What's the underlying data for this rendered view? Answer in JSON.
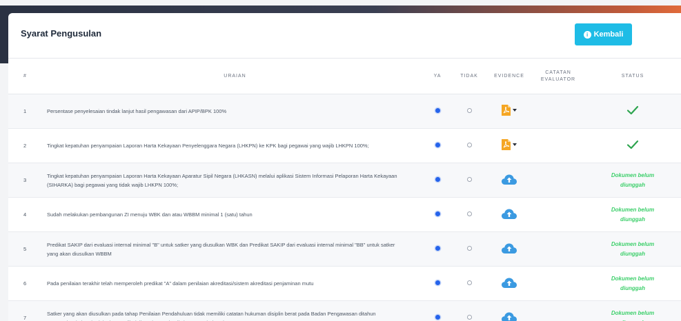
{
  "page": {
    "title": "Syarat Pengusulan",
    "back_button_label": "Kembali"
  },
  "table": {
    "columns": {
      "num": "#",
      "desc": "URAIAN",
      "ya": "YA",
      "tidak": "TIDAK",
      "evidence": "EVIDENCE",
      "catatan": "CATATAN EVALUATOR",
      "status": "STATUS"
    },
    "rows": [
      {
        "num": "1",
        "desc": "Persentase penyelesaian tindak lanjut hasil pengawasan dari APIP/BPK 100%",
        "ya": true,
        "evidence": "pdf-icon",
        "status": "check",
        "status_text": ""
      },
      {
        "num": "2",
        "desc": "Tingkat kepatuhan penyampaian Laporan Harta Kekayaan Penyelenggara Negara (LHKPN) ke KPK bagi pegawai yang wajib LHKPN 100%;",
        "ya": true,
        "evidence": "pdf-icon",
        "status": "check",
        "status_text": ""
      },
      {
        "num": "3",
        "desc": "Tingkat kepatuhan penyampaian Laporan Harta Kekayaan Aparatur Sipil Negara (LHKASN) melalui aplikasi Sistem Informasi Pelaporan Harta Kekayaan (SIHARKA) bagi pegawai yang tidak wajib LHKPN 100%;",
        "ya": true,
        "evidence": "cloud-upload-icon",
        "status": "text",
        "status_text": "Dokumen belum diunggah"
      },
      {
        "num": "4",
        "desc": "Sudah melakukan pembangunan ZI menuju WBK dan atau WBBM minimal 1 (satu) tahun",
        "ya": true,
        "evidence": "cloud-upload-icon",
        "status": "text",
        "status_text": "Dokumen belum diunggah"
      },
      {
        "num": "5",
        "desc": "Predikat SAKIP dari evaluasi internal minimal \"B\" untuk satker yang diusulkan WBK dan Predikat SAKIP dari evaluasi internal minimal \"BB\" untuk satker yang akan diusulkan WBBM",
        "ya": true,
        "evidence": "cloud-upload-icon",
        "status": "text",
        "status_text": "Dokumen belum diunggah"
      },
      {
        "num": "6",
        "desc": "Pada penilaian terakhir telah memperoleh predikat \"A\" dalam penilaian akreditasi/sistem akreditasi penjaminan mutu",
        "ya": true,
        "evidence": "cloud-upload-icon",
        "status": "text",
        "status_text": "Dokumen belum diunggah"
      },
      {
        "num": "7",
        "desc": "Satker yang akan diusulkan pada tahap Penilaian Pendahuluan tidak memiliki catatan hukuman disiplin berat pada Badan Pengawasan ditahun pengusulan (tahun berjalan) yang dibuktikan dengan hasil clearance dari Badan Pengawasan MA RI",
        "ya": true,
        "evidence": "cloud-upload-icon",
        "status": "text",
        "status_text": "Dokumen belum diunggah"
      }
    ]
  },
  "colors": {
    "accent_button": "#1ebce6",
    "radio_selected": "#2563eb",
    "status_ok": "#2da44e",
    "status_pending": "#3ccf6a",
    "pdf": "#f5a623",
    "cloud": "#3b9ae1"
  }
}
